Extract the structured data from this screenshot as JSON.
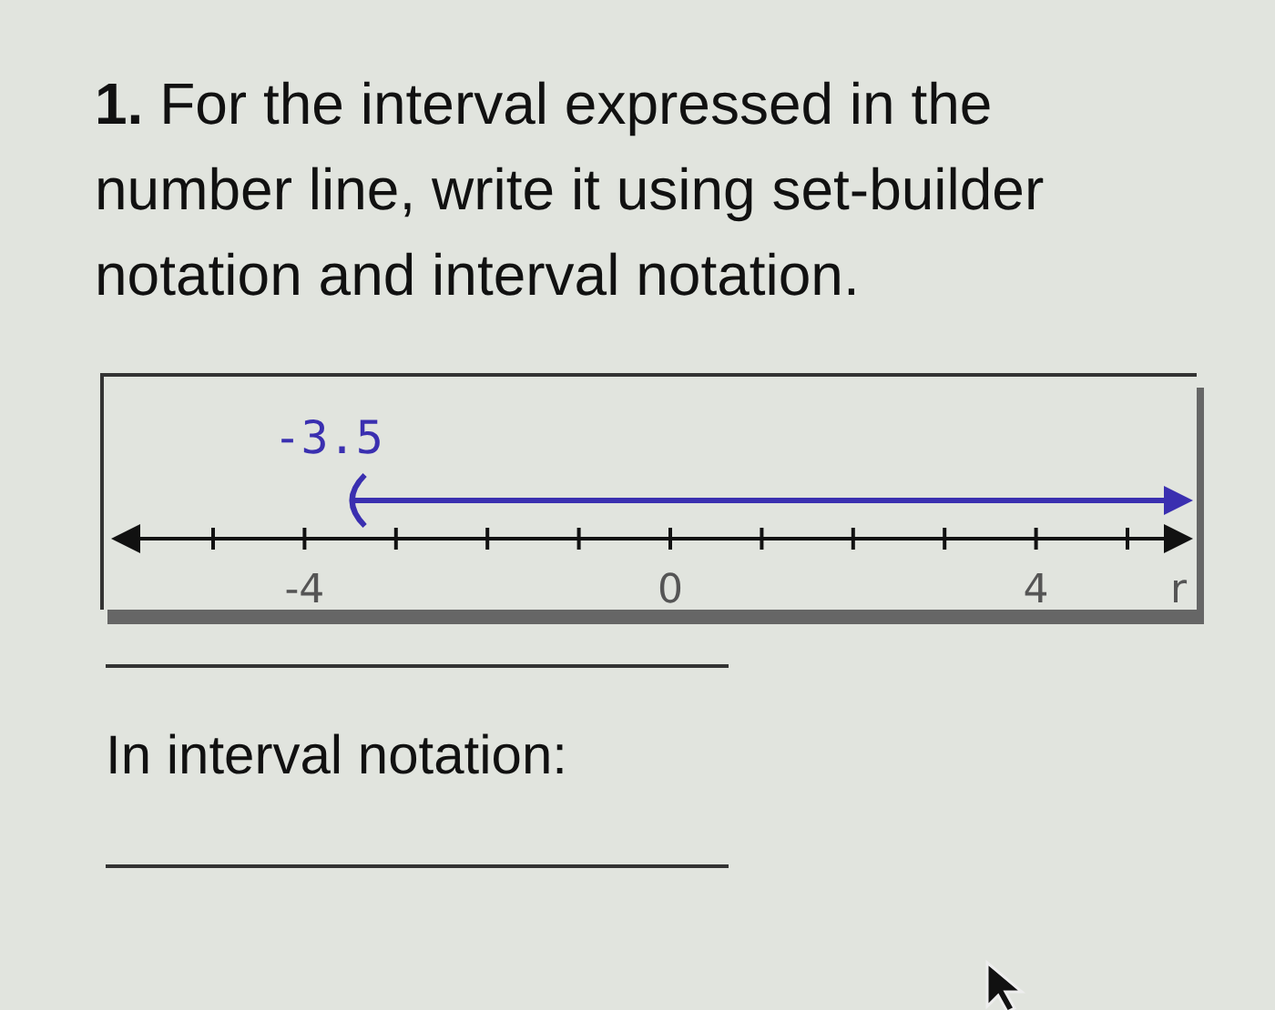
{
  "question": "**1.** For the interval expressed in the number line, write it using set-builder notation and interval notation.",
  "number_line": {
    "point_label": "-3.5",
    "endpoint_open": true,
    "tick_labels": [
      "-4",
      "0",
      "4"
    ],
    "variable": "r"
  },
  "interval_prompt": "In interval notation:"
}
